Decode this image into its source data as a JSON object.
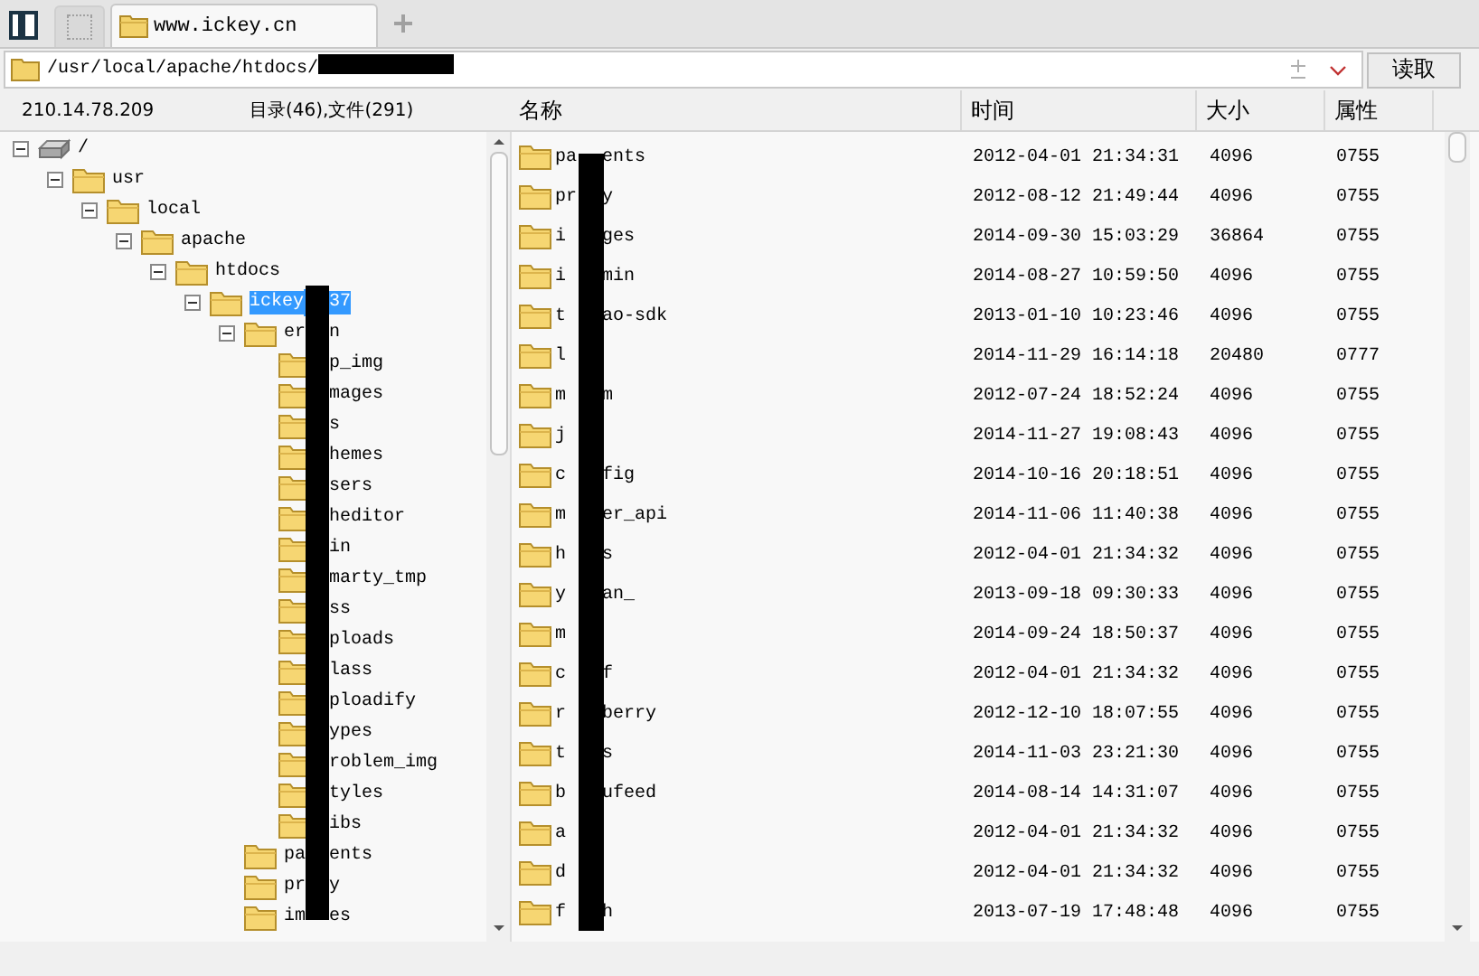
{
  "tab_strip": {
    "tabs": [
      {
        "label": "www.ickey.cn",
        "selected": true
      }
    ]
  },
  "address_bar": {
    "path": "/usr/local/apache/htdocs/",
    "button": "读取"
  },
  "status": {
    "host": "210.14.78.209",
    "summary": "目录(46),文件(291)"
  },
  "tree": {
    "children": [
      {
        "kind": "drive",
        "name_start": "/",
        "expanded": true,
        "selected": false,
        "children": [
          {
            "kind": "folder",
            "name_start": "usr",
            "expanded": true,
            "selected": false,
            "children": [
              {
                "kind": "folder",
                "name_start": "local",
                "expanded": true,
                "selected": false,
                "children": [
                  {
                    "kind": "folder",
                    "name_start": "apache",
                    "expanded": true,
                    "selected": false,
                    "children": [
                      {
                        "kind": "folder",
                        "name_start": "htdocs",
                        "expanded": true,
                        "selected": false,
                        "children": [
                          {
                            "kind": "folder",
                            "name_start": "ickey",
                            "name_end": "37",
                            "expanded": true,
                            "selected": true,
                            "children": [
                              {
                                "kind": "folder",
                                "name_start": "er",
                                "name_end": "n",
                                "expanded": true,
                                "selected": false,
                                "children": [
                                  {
                                    "kind": "folder",
                                    "name_end": "p_img",
                                    "selected": false
                                  },
                                  {
                                    "kind": "folder",
                                    "name_end": "mages",
                                    "selected": false
                                  },
                                  {
                                    "kind": "folder",
                                    "name_end": "s",
                                    "selected": false
                                  },
                                  {
                                    "kind": "folder",
                                    "name_end": "hemes",
                                    "selected": false
                                  },
                                  {
                                    "kind": "folder",
                                    "name_end": "sers",
                                    "selected": false
                                  },
                                  {
                                    "kind": "folder",
                                    "name_end": "heditor",
                                    "selected": false
                                  },
                                  {
                                    "kind": "folder",
                                    "name_end": "in",
                                    "selected": false
                                  },
                                  {
                                    "kind": "folder",
                                    "name_end": "marty_tmp",
                                    "selected": false
                                  },
                                  {
                                    "kind": "folder",
                                    "name_end": "ss",
                                    "selected": false
                                  },
                                  {
                                    "kind": "folder",
                                    "name_end": "ploads",
                                    "selected": false
                                  },
                                  {
                                    "kind": "folder",
                                    "name_end": "lass",
                                    "selected": false
                                  },
                                  {
                                    "kind": "folder",
                                    "name_end": "ploadify",
                                    "selected": false
                                  },
                                  {
                                    "kind": "folder",
                                    "name_end": "ypes",
                                    "selected": false
                                  },
                                  {
                                    "kind": "folder",
                                    "name_end": "roblem_img",
                                    "selected": false
                                  },
                                  {
                                    "kind": "folder",
                                    "name_end": "tyles",
                                    "selected": false
                                  },
                                  {
                                    "kind": "folder",
                                    "name_end": "ibs",
                                    "selected": false
                                  }
                                ]
                              },
                              {
                                "kind": "folder",
                                "name_start": "pa",
                                "name_end": "ents",
                                "selected": false
                              },
                              {
                                "kind": "folder",
                                "name_start": "pr",
                                "name_end": "y",
                                "selected": false
                              },
                              {
                                "kind": "folder",
                                "name_start": "im",
                                "name_end": "es",
                                "selected": false
                              }
                            ]
                          }
                        ]
                      }
                    ]
                  }
                ]
              }
            ]
          }
        ]
      }
    ]
  },
  "table": {
    "columns": [
      "名称",
      "时间",
      "大小",
      "属性"
    ],
    "rows": [
      {
        "name_start": "pa",
        "name_end": "ents",
        "time": "2012-04-01 21:34:31",
        "size": "4096",
        "attr": "0755"
      },
      {
        "name_start": "pr",
        "name_end": "y",
        "time": "2012-08-12 21:49:44",
        "size": "4096",
        "attr": "0755"
      },
      {
        "name_start": "i",
        "name_end": "ges",
        "time": "2014-09-30 15:03:29",
        "size": "36864",
        "attr": "0755"
      },
      {
        "name_start": "i",
        "name_end": "min",
        "time": "2014-08-27 10:59:50",
        "size": "4096",
        "attr": "0755"
      },
      {
        "name_start": "t",
        "name_end": "ao-sdk",
        "time": "2013-01-10 10:23:46",
        "size": "4096",
        "attr": "0755"
      },
      {
        "name_start": "l",
        "time": "2014-11-29 16:14:18",
        "size": "20480",
        "attr": "0777"
      },
      {
        "name_start": "m",
        "name_end": "m",
        "time": "2012-07-24 18:52:24",
        "size": "4096",
        "attr": "0755"
      },
      {
        "name_start": "j",
        "time": "2014-11-27 19:08:43",
        "size": "4096",
        "attr": "0755"
      },
      {
        "name_start": "c",
        "name_end": "fig",
        "time": "2014-10-16 20:18:51",
        "size": "4096",
        "attr": "0755"
      },
      {
        "name_start": "m",
        "name_end": "er_api",
        "time": "2014-11-06 11:40:38",
        "size": "4096",
        "attr": "0755"
      },
      {
        "name_start": "h",
        "name_end": "s",
        "time": "2012-04-01 21:34:32",
        "size": "4096",
        "attr": "0755"
      },
      {
        "name_start": "y",
        "name_end": "an_",
        "time": "2013-09-18 09:30:33",
        "size": "4096",
        "attr": "0755"
      },
      {
        "name_start": "m",
        "time": "2014-09-24 18:50:37",
        "size": "4096",
        "attr": "0755"
      },
      {
        "name_start": "c",
        "name_end": "f",
        "time": "2012-04-01 21:34:32",
        "size": "4096",
        "attr": "0755"
      },
      {
        "name_start": "r",
        "name_end": "berry",
        "time": "2012-12-10 18:07:55",
        "size": "4096",
        "attr": "0755"
      },
      {
        "name_start": "t",
        "name_end": "s",
        "time": "2014-11-03 23:21:30",
        "size": "4096",
        "attr": "0755"
      },
      {
        "name_start": "b",
        "name_end": "ufeed",
        "time": "2014-08-14 14:31:07",
        "size": "4096",
        "attr": "0755"
      },
      {
        "name_start": "a",
        "time": "2012-04-01 21:34:32",
        "size": "4096",
        "attr": "0755"
      },
      {
        "name_start": "d",
        "time": "2012-04-01 21:34:32",
        "size": "4096",
        "attr": "0755"
      },
      {
        "name_start": "f",
        "name_end": "h",
        "time": "2013-07-19 17:48:48",
        "size": "4096",
        "attr": "0755"
      }
    ]
  }
}
